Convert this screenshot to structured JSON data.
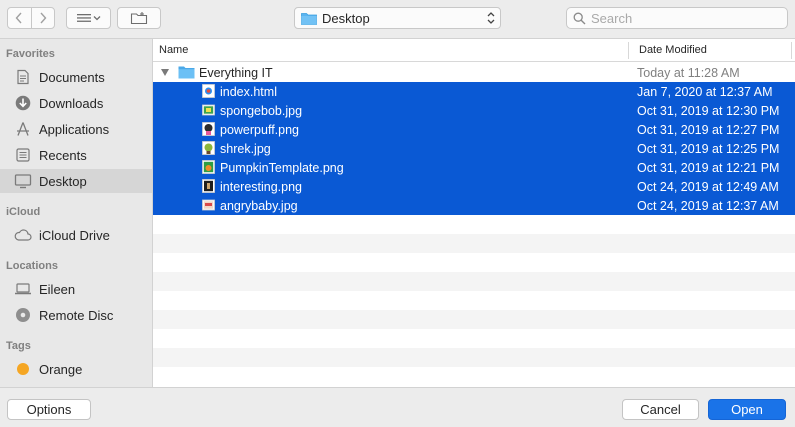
{
  "toolbar": {
    "location": "Desktop",
    "search_placeholder": "Search"
  },
  "sidebar": {
    "sections": [
      {
        "heading": "Favorites"
      },
      {
        "heading": "iCloud"
      },
      {
        "heading": "Locations"
      },
      {
        "heading": "Tags"
      }
    ],
    "items": [
      {
        "label": "Documents",
        "icon": "documents-icon"
      },
      {
        "label": "Downloads",
        "icon": "downloads-icon"
      },
      {
        "label": "Applications",
        "icon": "applications-icon"
      },
      {
        "label": "Recents",
        "icon": "recents-icon"
      },
      {
        "label": "Desktop",
        "icon": "desktop-icon",
        "selected": true
      },
      {
        "label": "iCloud Drive",
        "icon": "cloud-icon"
      },
      {
        "label": "Eileen",
        "icon": "laptop-icon"
      },
      {
        "label": "Remote Disc",
        "icon": "disc-icon"
      },
      {
        "label": "Orange",
        "icon": "orange-tag-icon"
      }
    ]
  },
  "list": {
    "headers": {
      "name": "Name",
      "date": "Date Modified"
    },
    "folder": {
      "name": "Everything IT",
      "date": "Today at 11:28 AM",
      "expanded": true
    },
    "files": [
      {
        "name": "index.html",
        "date": "Jan 7, 2020 at 12:37 AM",
        "icon": "html-file-icon"
      },
      {
        "name": "spongebob.jpg",
        "date": "Oct 31, 2019 at 12:30 PM",
        "icon": "image-file-icon"
      },
      {
        "name": "powerpuff.png",
        "date": "Oct 31, 2019 at 12:27 PM",
        "icon": "image-file-icon"
      },
      {
        "name": "shrek.jpg",
        "date": "Oct 31, 2019 at 12:25 PM",
        "icon": "image-file-icon"
      },
      {
        "name": "PumpkinTemplate.png",
        "date": "Oct 31, 2019 at 12:21 PM",
        "icon": "image-file-icon"
      },
      {
        "name": "interesting.png",
        "date": "Oct 24, 2019 at 12:49 AM",
        "icon": "image-file-icon"
      },
      {
        "name": "angrybaby.jpg",
        "date": "Oct 24, 2019 at 12:37 AM",
        "icon": "image-file-icon"
      }
    ]
  },
  "buttons": {
    "options": "Options",
    "cancel": "Cancel",
    "open": "Open"
  },
  "colors": {
    "selection": "#0a59d4",
    "accent": "#1a73e8",
    "folder": "#5ab4f0",
    "tag_orange": "#f5a623"
  }
}
